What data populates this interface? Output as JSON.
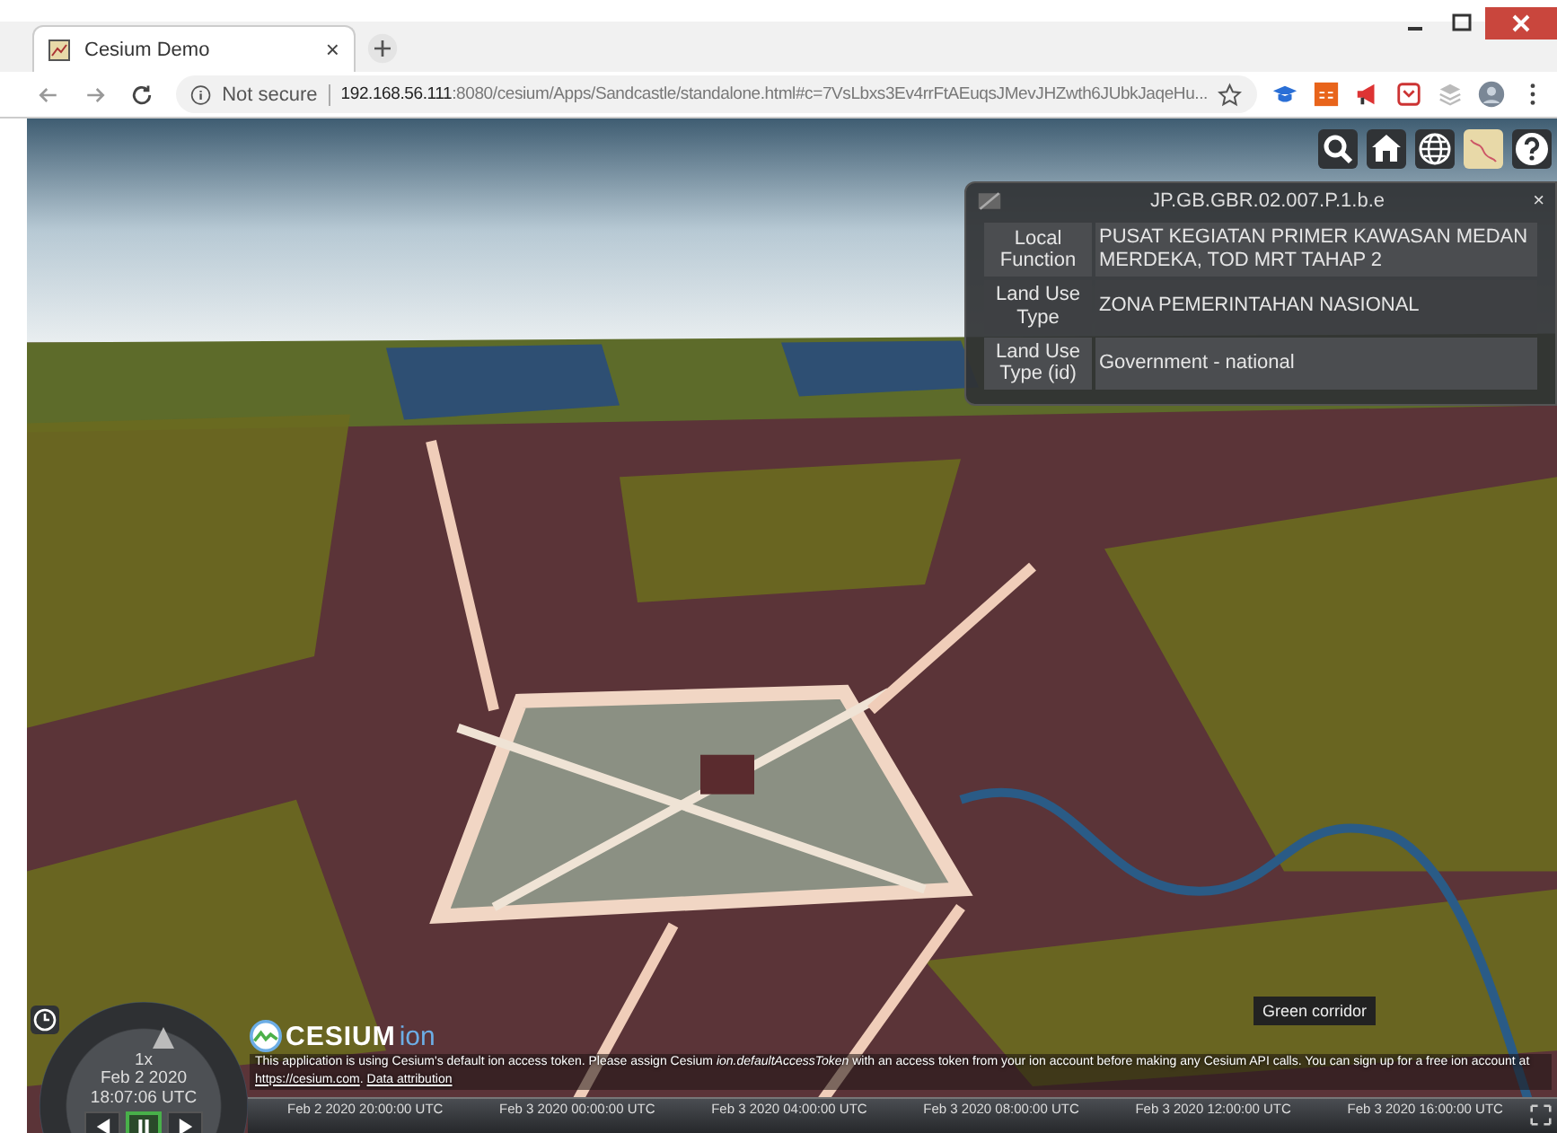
{
  "browser": {
    "tab": {
      "title": "Cesium Demo",
      "close": "×"
    },
    "address_bar": {
      "security": "Not secure",
      "url_host": "192.168.56.111",
      "url_rest": ":8080/cesium/Apps/Sandcastle/standalone.html#c=7VsLbxs3Ev4rrFtAEuqsJMevJHZwth6JUbkJaqeHu..."
    }
  },
  "info_box": {
    "title": "JP.GB.GBR.02.007.P.1.b.e",
    "close": "×",
    "rows": [
      {
        "label": "Local Function",
        "value": "PUSAT KEGIATAN PRIMER KAWASAN MEDAN MERDEKA, TOD MRT TAHAP 2"
      },
      {
        "label": "Land Use Type",
        "value": "ZONA PEMERINTAHAN NASIONAL"
      },
      {
        "label": "Land Use Type (id)",
        "value": "Government - national"
      }
    ]
  },
  "tooltip": "Green corridor",
  "animation": {
    "speed": "1x",
    "date": "Feb 2 2020",
    "time": "18:07:06 UTC",
    "buttons": [
      {
        "kind": "reverse",
        "selected": false
      },
      {
        "kind": "pause",
        "selected": true
      },
      {
        "kind": "play",
        "selected": false
      }
    ]
  },
  "credits": {
    "logo_text": "CESIUM",
    "logo_suffix": "ion",
    "notice": "This application is using Cesium's default ion access token. Please assign Cesium *ion.defaultAccessToken* with an access token from your ion account before making any Cesium API calls. You can sign up for a free ion account at",
    "link": "https://cesium.com",
    "after_link": ".",
    "attribution": "Data attribution"
  },
  "timeline": {
    "ticks": [
      "Feb 2 2020 20:00:00 UTC",
      "Feb 3 2020 00:00:00 UTC",
      "Feb 3 2020 04:00:00 UTC",
      "Feb 3 2020 08:00:00 UTC",
      "Feb 3 2020 12:00:00 UTC",
      "Feb 3 2020 16:00:00 UTC"
    ]
  }
}
